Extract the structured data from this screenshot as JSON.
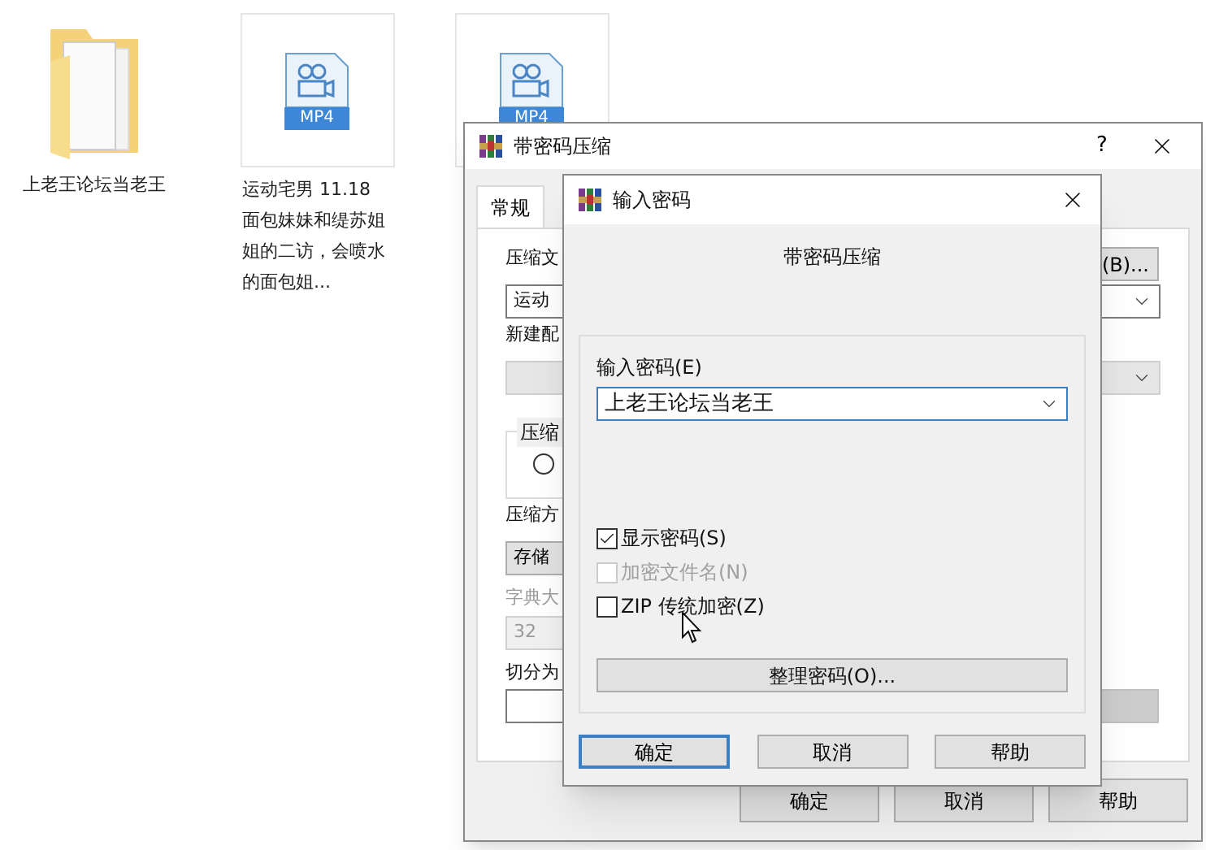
{
  "desktop_icons": [
    {
      "kind": "folder",
      "label": "上老王论坛当老王"
    },
    {
      "kind": "video",
      "badge": "MP4",
      "label": "运动宅男 11.18 面包妹妹和缇苏姐姐的二访，会喷水的面包姐..."
    },
    {
      "kind": "video",
      "badge": "MP4"
    }
  ],
  "back_dialog": {
    "title": "带密码压缩",
    "help_button": "?",
    "tabs": [
      {
        "label": "常规",
        "selected": true
      }
    ],
    "browse_button": "(B)...",
    "rows": [
      {
        "kind": "combo",
        "label": "压缩文",
        "value": "运动",
        "disabled": false
      },
      {
        "kind": "combo",
        "label": "新建配",
        "disabled": true
      },
      {
        "kind": "group",
        "label": "压缩",
        "radio_selected": false
      },
      {
        "kind": "select",
        "label": "压缩方",
        "value": "存储",
        "disabled": false
      },
      {
        "kind": "field",
        "label": "字典大",
        "value": "32",
        "disabled": true
      },
      {
        "kind": "field",
        "label": "切分为",
        "disabled": false
      }
    ],
    "buttons": [
      "确定",
      "取消",
      "帮助"
    ]
  },
  "front_dialog": {
    "title": "输入密码",
    "heading": "带密码压缩",
    "password_label": "输入密码(E)",
    "password_value": "上老王论坛当老王",
    "options": [
      {
        "label": "显示密码(S)",
        "checked": true,
        "disabled": false
      },
      {
        "label": "加密文件名(N)",
        "checked": false,
        "disabled": true
      },
      {
        "label": "ZIP 传统加密(Z)",
        "checked": false,
        "disabled": false
      }
    ],
    "organize_button": "整理密码(O)...",
    "buttons": [
      {
        "label": "确定",
        "focused": true
      },
      {
        "label": "取消",
        "focused": false
      },
      {
        "label": "帮助",
        "focused": false
      }
    ]
  }
}
